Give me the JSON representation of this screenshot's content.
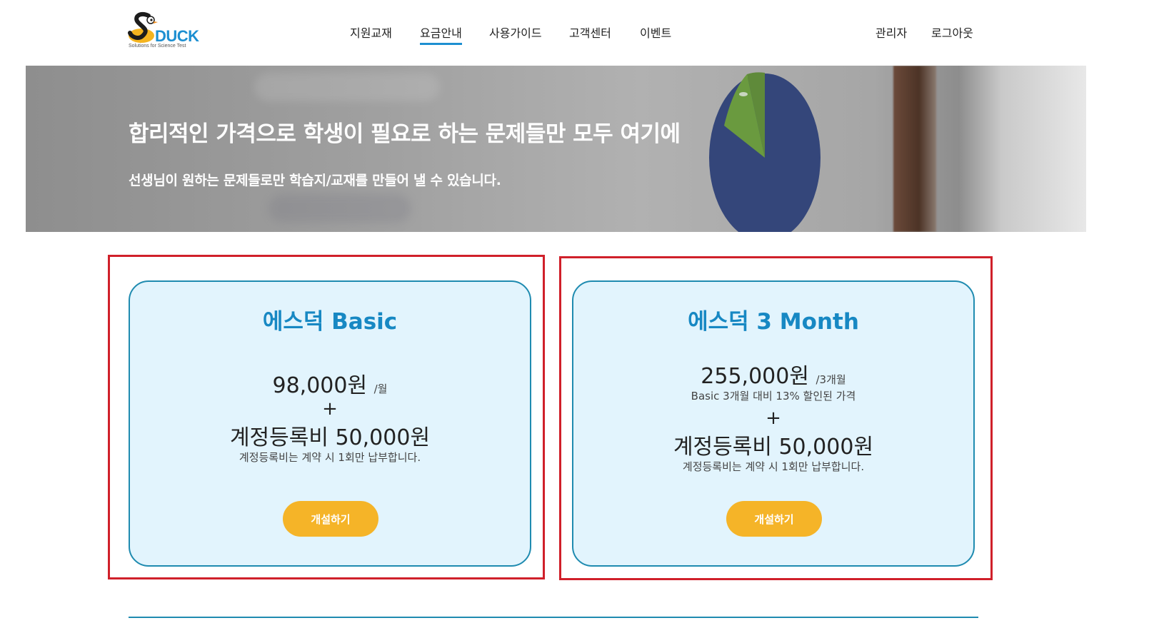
{
  "header": {
    "logo": {
      "brand": "DUCK",
      "letter": "S",
      "tagline": "Solutions for Science Test"
    },
    "nav": [
      {
        "label": "지원교재",
        "active": false
      },
      {
        "label": "요금안내",
        "active": true
      },
      {
        "label": "사용가이드",
        "active": false
      },
      {
        "label": "고객센터",
        "active": false
      },
      {
        "label": "이벤트",
        "active": false
      }
    ],
    "user_menu": {
      "admin": "관리자",
      "logout": "로그아웃"
    }
  },
  "hero": {
    "title": "합리적인 가격으로 학생이 필요로 하는 문제들만 모두 여기에",
    "subtitle": "선생님이 원하는 문제들로만 학습지/교재를 만들어 낼 수 있습니다."
  },
  "plans": [
    {
      "name": "에스덕 Basic",
      "price": "98,000원",
      "period": "/월",
      "discount_note": "",
      "plus": "+",
      "fee": "계정등록비 50,000원",
      "fee_note": "계정등록비는 계약 시 1회만 납부합니다.",
      "button": "개설하기"
    },
    {
      "name": "에스덕 3 Month",
      "price": "255,000원",
      "period": "/3개월",
      "discount_note": "Basic 3개월 대비 13% 할인된 가격",
      "plus": "+",
      "fee": "계정등록비 50,000원",
      "fee_note": "계정등록비는 계약 시 1회만 납부합니다.",
      "button": "개설하기"
    }
  ],
  "colors": {
    "accent_blue": "#1788c3",
    "card_bg": "#e2f4fd",
    "card_border": "#1f8bb0",
    "button": "#f5b428",
    "highlight_box": "#d0202a"
  }
}
